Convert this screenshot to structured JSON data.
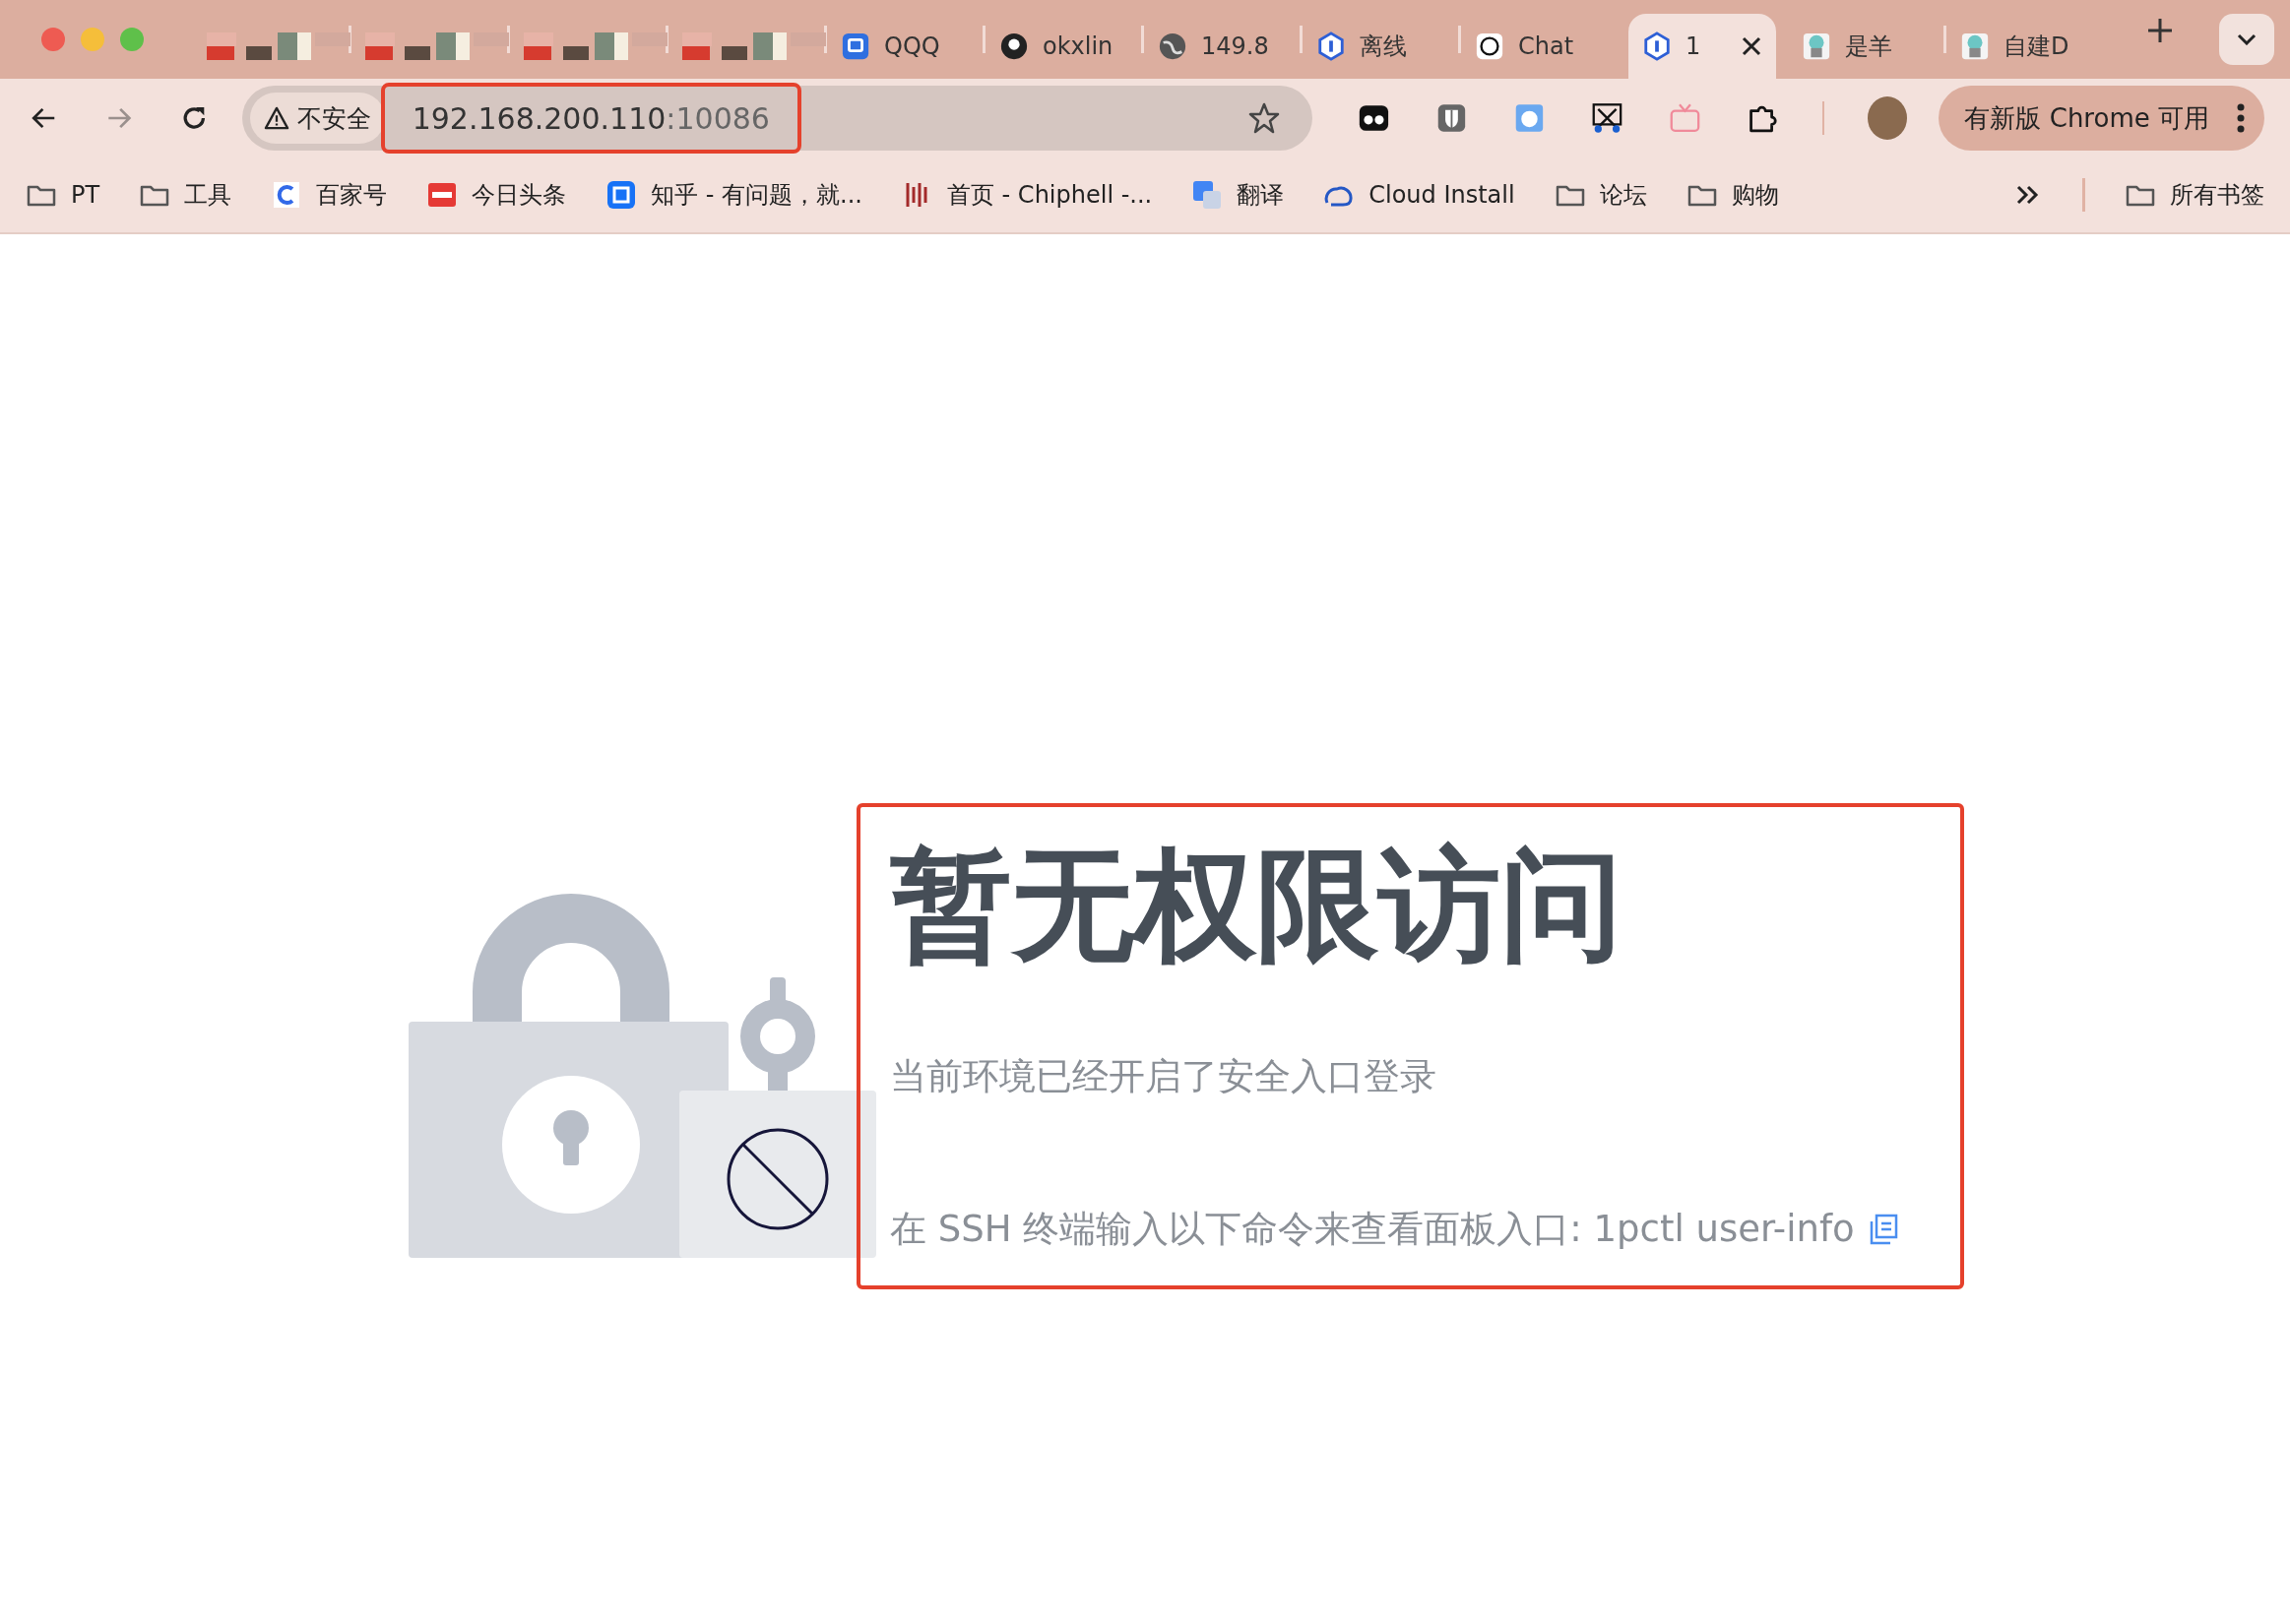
{
  "tabs": [
    {
      "kind": "blurred",
      "selected": false
    },
    {
      "kind": "blurred",
      "selected": false
    },
    {
      "kind": "blurred",
      "selected": false
    },
    {
      "kind": "blurred",
      "selected": false
    },
    {
      "kind": "page",
      "title": "QQQ",
      "selected": false
    },
    {
      "kind": "page",
      "title": "okxlin",
      "selected": false
    },
    {
      "kind": "page",
      "title": "149.8",
      "selected": false
    },
    {
      "kind": "page",
      "title": "离线",
      "selected": false
    },
    {
      "kind": "page",
      "title": "Chat",
      "selected": false
    },
    {
      "kind": "page",
      "title": "1",
      "selected": true
    },
    {
      "kind": "page",
      "title": "是羊",
      "selected": false
    },
    {
      "kind": "page",
      "title": "自建D",
      "selected": false
    }
  ],
  "toolbar": {
    "back_enabled": true,
    "forward_enabled": false,
    "security_label": "不安全",
    "url_host": "192.168.200.110",
    "url_port": ":10086",
    "update_button": "有新版 Chrome 可用"
  },
  "bookmarks": [
    {
      "kind": "folder",
      "label": "PT"
    },
    {
      "kind": "folder",
      "label": "工具"
    },
    {
      "kind": "site",
      "label": "百家号"
    },
    {
      "kind": "site",
      "label": "今日头条"
    },
    {
      "kind": "site",
      "label": "知乎 - 有问题，就..."
    },
    {
      "kind": "site",
      "label": "首页 - Chiphell -..."
    },
    {
      "kind": "site",
      "label": "翻译"
    },
    {
      "kind": "site",
      "label": "Cloud Install"
    },
    {
      "kind": "folder",
      "label": "论坛"
    },
    {
      "kind": "folder",
      "label": "购物"
    }
  ],
  "all_bookmarks": "所有书签",
  "content": {
    "title": "暂无权限访问",
    "subtitle": "当前环境已经开启了安全入口登录",
    "hint": "在 SSH 终端输入以下命令来查看面板入口: 1pctl user-info"
  }
}
